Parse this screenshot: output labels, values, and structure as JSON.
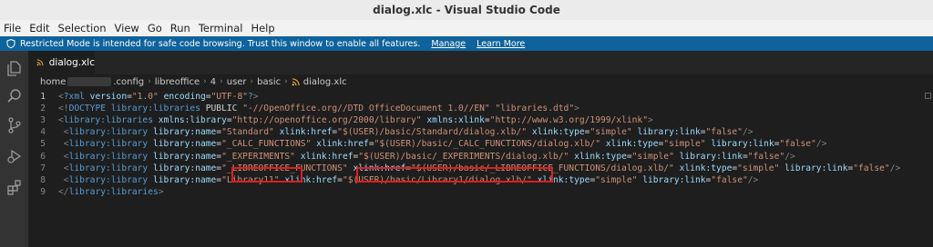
{
  "window": {
    "title": "dialog.xlc - Visual Studio Code"
  },
  "menu": [
    "File",
    "Edit",
    "Selection",
    "View",
    "Go",
    "Run",
    "Terminal",
    "Help"
  ],
  "restricted": {
    "message": "Restricted Mode is intended for safe code browsing. Trust this window to enable all features.",
    "manage": "Manage",
    "learn_more": "Learn More"
  },
  "tab": {
    "label": "dialog.xlc"
  },
  "breadcrumb": {
    "items": [
      "home",
      ".config",
      "libreoffice",
      "4",
      "user",
      "basic"
    ],
    "file": "dialog.xlc"
  },
  "editor": {
    "line_numbers": [
      "1",
      "2",
      "3",
      "4",
      "5",
      "6",
      "7",
      "8",
      "9"
    ],
    "lines": [
      [
        [
          "punc",
          "<"
        ],
        [
          "tag",
          "?xml"
        ],
        [
          "code",
          " "
        ],
        [
          "attr",
          "version"
        ],
        [
          "code",
          "="
        ],
        [
          "str",
          "\"1.0\""
        ],
        [
          "code",
          " "
        ],
        [
          "attr",
          "encoding"
        ],
        [
          "code",
          "="
        ],
        [
          "str",
          "\"UTF-8\""
        ],
        [
          "tag",
          "?"
        ],
        [
          "punc",
          ">"
        ]
      ],
      [
        [
          "punc",
          "<!"
        ],
        [
          "tag",
          "DOCTYPE"
        ],
        [
          "code",
          " "
        ],
        [
          "tag",
          "library:libraries"
        ],
        [
          "code",
          " PUBLIC "
        ],
        [
          "str",
          "\"-//OpenOffice.org//DTD OfficeDocument 1.0//EN\""
        ],
        [
          "code",
          " "
        ],
        [
          "str",
          "\"libraries.dtd\""
        ],
        [
          "punc",
          ">"
        ]
      ],
      [
        [
          "punc",
          "<"
        ],
        [
          "tag",
          "library:libraries"
        ],
        [
          "code",
          " "
        ],
        [
          "attr",
          "xmlns:library"
        ],
        [
          "code",
          "="
        ],
        [
          "str",
          "\"http://openoffice.org/2000/library\""
        ],
        [
          "code",
          " "
        ],
        [
          "attr",
          "xmlns:xlink"
        ],
        [
          "code",
          "="
        ],
        [
          "str",
          "\"http://www.w3.org/1999/xlink\""
        ],
        [
          "punc",
          ">"
        ]
      ],
      [
        [
          "code",
          " "
        ],
        [
          "punc",
          "<"
        ],
        [
          "tag",
          "library:library"
        ],
        [
          "code",
          " "
        ],
        [
          "attr",
          "library:name"
        ],
        [
          "code",
          "="
        ],
        [
          "str",
          "\"Standard\""
        ],
        [
          "code",
          " "
        ],
        [
          "attr",
          "xlink:href"
        ],
        [
          "code",
          "="
        ],
        [
          "str",
          "\"$(USER)/basic/Standard/dialog.xlb/\""
        ],
        [
          "code",
          " "
        ],
        [
          "attr",
          "xlink:type"
        ],
        [
          "code",
          "="
        ],
        [
          "str",
          "\"simple\""
        ],
        [
          "code",
          " "
        ],
        [
          "attr",
          "library:link"
        ],
        [
          "code",
          "="
        ],
        [
          "str",
          "\"false\""
        ],
        [
          "punc",
          "/>"
        ]
      ],
      [
        [
          "code",
          " "
        ],
        [
          "punc",
          "<"
        ],
        [
          "tag",
          "library:library"
        ],
        [
          "code",
          " "
        ],
        [
          "attr",
          "library:name"
        ],
        [
          "code",
          "="
        ],
        [
          "str",
          "\"_CALC_FUNCTIONS\""
        ],
        [
          "code",
          " "
        ],
        [
          "attr",
          "xlink:href"
        ],
        [
          "code",
          "="
        ],
        [
          "str",
          "\"$(USER)/basic/_CALC_FUNCTIONS/dialog.xlb/\""
        ],
        [
          "code",
          " "
        ],
        [
          "attr",
          "xlink:type"
        ],
        [
          "code",
          "="
        ],
        [
          "str",
          "\"simple\""
        ],
        [
          "code",
          " "
        ],
        [
          "attr",
          "library:link"
        ],
        [
          "code",
          "="
        ],
        [
          "str",
          "\"false\""
        ],
        [
          "punc",
          "/>"
        ]
      ],
      [
        [
          "code",
          " "
        ],
        [
          "punc",
          "<"
        ],
        [
          "tag",
          "library:library"
        ],
        [
          "code",
          " "
        ],
        [
          "attr",
          "library:name"
        ],
        [
          "code",
          "="
        ],
        [
          "str",
          "\"_EXPERIMENTS\""
        ],
        [
          "code",
          " "
        ],
        [
          "attr",
          "xlink:href"
        ],
        [
          "code",
          "="
        ],
        [
          "str",
          "\"$(USER)/basic/_EXPERIMENTS/dialog.xlb/\""
        ],
        [
          "code",
          " "
        ],
        [
          "attr",
          "xlink:type"
        ],
        [
          "code",
          "="
        ],
        [
          "str",
          "\"simple\""
        ],
        [
          "code",
          " "
        ],
        [
          "attr",
          "library:link"
        ],
        [
          "code",
          "="
        ],
        [
          "str",
          "\"false\""
        ],
        [
          "punc",
          "/>"
        ]
      ],
      [
        [
          "code",
          " "
        ],
        [
          "punc",
          "<"
        ],
        [
          "tag",
          "library:library"
        ],
        [
          "code",
          " "
        ],
        [
          "attr",
          "library:name"
        ],
        [
          "code",
          "="
        ],
        [
          "str",
          "\"_LIBREOFFICE_FUNCTIONS\""
        ],
        [
          "code",
          " "
        ],
        [
          "attr",
          "xlink:href"
        ],
        [
          "code",
          "="
        ],
        [
          "str",
          "\"$(USER)/basic/_LIBREOFFICE_FUNCTIONS/dialog.xlb/\""
        ],
        [
          "code",
          " "
        ],
        [
          "attr",
          "xlink:type"
        ],
        [
          "code",
          "="
        ],
        [
          "str",
          "\"simple\""
        ],
        [
          "code",
          " "
        ],
        [
          "attr",
          "library:link"
        ],
        [
          "code",
          "="
        ],
        [
          "str",
          "\"false\""
        ],
        [
          "punc",
          "/>"
        ]
      ],
      [
        [
          "code",
          " "
        ],
        [
          "punc",
          "<"
        ],
        [
          "tag",
          "library:library"
        ],
        [
          "code",
          " "
        ],
        [
          "attr",
          "library:name"
        ],
        [
          "code",
          "="
        ],
        [
          "str",
          "\"Library11\""
        ],
        [
          "code",
          " "
        ],
        [
          "attr",
          "xlink:href"
        ],
        [
          "code",
          "="
        ],
        [
          "str",
          "\"$(USER)/basic/Library1/dialog.xlb/\""
        ],
        [
          "code",
          " "
        ],
        [
          "attr",
          "xlink:type"
        ],
        [
          "code",
          "="
        ],
        [
          "str",
          "\"simple\""
        ],
        [
          "code",
          " "
        ],
        [
          "attr",
          "library:link"
        ],
        [
          "code",
          "="
        ],
        [
          "str",
          "\"false\""
        ],
        [
          "punc",
          "/>"
        ]
      ],
      [
        [
          "punc",
          "</"
        ],
        [
          "tag",
          "library:libraries"
        ],
        [
          "punc",
          ">"
        ]
      ]
    ]
  },
  "colors": {
    "accent": "#0e639c",
    "highlight": "#e11d1d",
    "rss": "#e8a33d"
  }
}
